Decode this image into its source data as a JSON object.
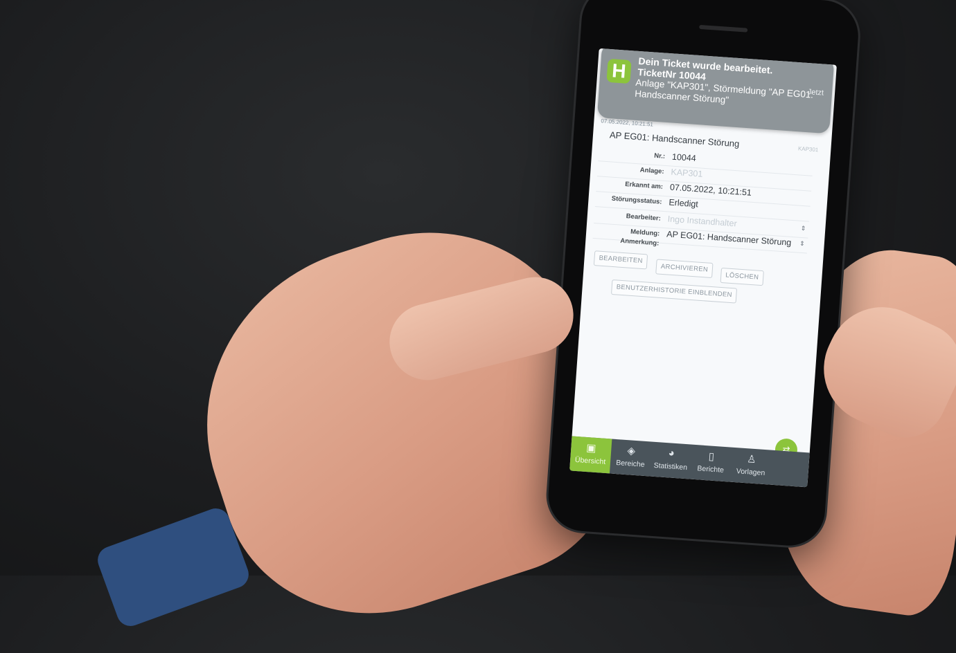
{
  "notification": {
    "app_icon": "H",
    "title": "Dein Ticket wurde bearbeitet.",
    "subtitle": "TicketNr 10044",
    "body": "Anlage \"KAP301\", Störmeldung \"AP EG01: Handscanner Störung\"",
    "time": "Jetzt"
  },
  "ticket": {
    "date_line": "07.05.2022, 10:21:51",
    "title": "AP EG01: Handscanner Störung",
    "code": "KAP301",
    "fields": {
      "nr": {
        "label": "Nr.:",
        "value": "10044"
      },
      "anlage": {
        "label": "Anlage:",
        "value": "KAP301"
      },
      "erkannt": {
        "label": "Erkannt am:",
        "value": "07.05.2022, 10:21:51"
      },
      "status": {
        "label": "Störungsstatus:",
        "value": "Erledigt"
      },
      "bearbeiter": {
        "label": "Bearbeiter:",
        "value": "Ingo Instandhalter"
      },
      "meldung": {
        "label": "Meldung:",
        "value": "AP EG01: Handscanner Störung"
      },
      "anmerkung": {
        "label": "Anmerkung:",
        "value": ""
      }
    },
    "buttons": {
      "edit": "BEARBEITEN",
      "archive": "ARCHIVIEREN",
      "delete": "LÖSCHEN",
      "history": "BENUTZERHISTORIE EINBLENDEN"
    }
  },
  "tabs": [
    {
      "label": "Übersicht",
      "icon": "image-icon",
      "active": true
    },
    {
      "label": "Bereiche",
      "icon": "layers-icon"
    },
    {
      "label": "Statistiken",
      "icon": "pie-chart-icon"
    },
    {
      "label": "Berichte",
      "icon": "document-icon"
    },
    {
      "label": "Vorlagen",
      "icon": "user-icon"
    }
  ],
  "colors": {
    "accent": "#8cc43c",
    "tabbar": "#4a545b",
    "notification_bg": "#8e9599"
  }
}
